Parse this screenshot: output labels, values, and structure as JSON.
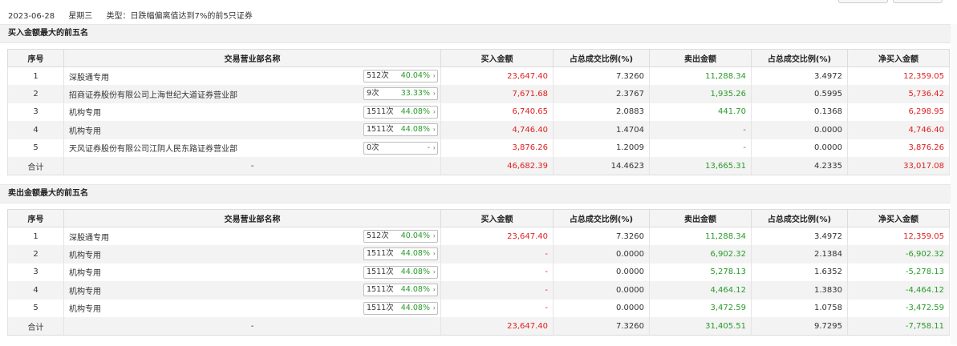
{
  "header": {
    "date": "2023-06-28",
    "weekday": "星期三",
    "type": "类型：日跌幅偏离值达到7%的前5只证券"
  },
  "columns": [
    "序号",
    "交易营业部名称",
    "买入金额",
    "占总成交比例(%)",
    "卖出金额",
    "占总成交比例(%)",
    "净买入金额"
  ],
  "buy": {
    "title": "买入金额最大的前五名",
    "rows": [
      {
        "no": "1",
        "name": "深股通专用",
        "count": "512次",
        "pct": "40.04%",
        "buy": "23,647.40",
        "buy_ratio": "7.3260",
        "sell": "11,288.34",
        "sell_ratio": "3.4972",
        "net": "12,359.05"
      },
      {
        "no": "2",
        "name": "招商证券股份有限公司上海世纪大道证券营业部",
        "count": "9次",
        "pct": "33.33%",
        "buy": "7,671.68",
        "buy_ratio": "2.3767",
        "sell": "1,935.26",
        "sell_ratio": "0.5995",
        "net": "5,736.42"
      },
      {
        "no": "3",
        "name": "机构专用",
        "count": "1511次",
        "pct": "44.08%",
        "buy": "6,740.65",
        "buy_ratio": "2.0883",
        "sell": "441.70",
        "sell_ratio": "0.1368",
        "net": "6,298.95"
      },
      {
        "no": "4",
        "name": "机构专用",
        "count": "1511次",
        "pct": "44.08%",
        "buy": "4,746.40",
        "buy_ratio": "1.4704",
        "sell": "-",
        "sell_ratio": "0.0000",
        "net": "4,746.40"
      },
      {
        "no": "5",
        "name": "天风证券股份有限公司江阴人民东路证券营业部",
        "count": "0次",
        "pct": "-",
        "buy": "3,876.26",
        "buy_ratio": "1.2009",
        "sell": "-",
        "sell_ratio": "0.0000",
        "net": "3,876.26"
      }
    ],
    "total": {
      "label": "合计",
      "name": "-",
      "buy": "46,682.39",
      "buy_ratio": "14.4623",
      "sell": "13,665.31",
      "sell_ratio": "4.2335",
      "net": "33,017.08"
    }
  },
  "sell": {
    "title": "卖出金额最大的前五名",
    "rows": [
      {
        "no": "1",
        "name": "深股通专用",
        "count": "512次",
        "pct": "40.04%",
        "buy": "23,647.40",
        "buy_ratio": "7.3260",
        "sell": "11,288.34",
        "sell_ratio": "3.4972",
        "net": "12,359.05"
      },
      {
        "no": "2",
        "name": "机构专用",
        "count": "1511次",
        "pct": "44.08%",
        "buy": "-",
        "buy_ratio": "0.0000",
        "sell": "6,902.32",
        "sell_ratio": "2.1384",
        "net": "-6,902.32"
      },
      {
        "no": "3",
        "name": "机构专用",
        "count": "1511次",
        "pct": "44.08%",
        "buy": "-",
        "buy_ratio": "0.0000",
        "sell": "5,278.13",
        "sell_ratio": "1.6352",
        "net": "-5,278.13"
      },
      {
        "no": "4",
        "name": "机构专用",
        "count": "1511次",
        "pct": "44.08%",
        "buy": "-",
        "buy_ratio": "0.0000",
        "sell": "4,464.12",
        "sell_ratio": "1.3830",
        "net": "-4,464.12"
      },
      {
        "no": "5",
        "name": "机构专用",
        "count": "1511次",
        "pct": "44.08%",
        "buy": "-",
        "buy_ratio": "0.0000",
        "sell": "3,472.59",
        "sell_ratio": "1.0758",
        "net": "-3,472.59"
      }
    ],
    "total": {
      "label": "合计",
      "name": "-",
      "buy": "23,647.40",
      "buy_ratio": "7.3260",
      "sell": "31,405.51",
      "sell_ratio": "9.7295",
      "net": "-7,758.11"
    }
  },
  "colors": {
    "positive": "#e02020",
    "negative": "#2a9a2a"
  }
}
